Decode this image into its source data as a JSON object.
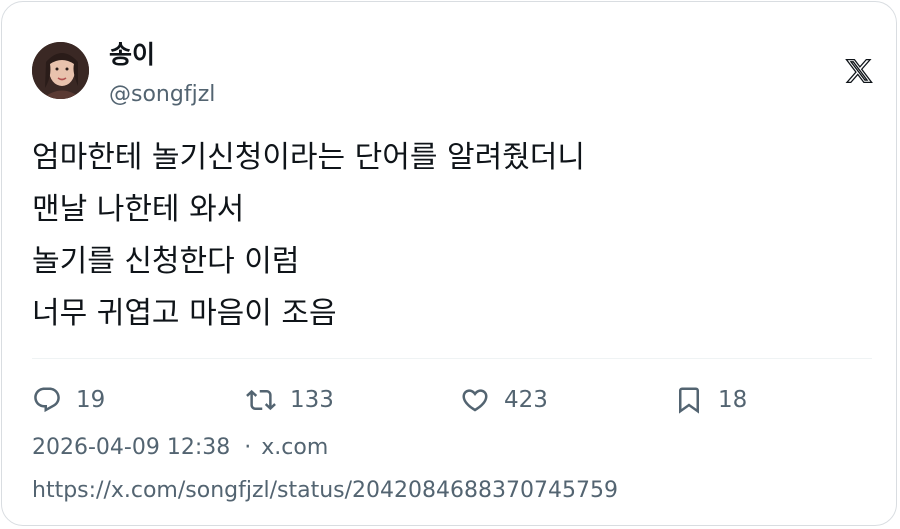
{
  "author": {
    "display_name": "송이",
    "handle": "@songfjzl",
    "avatar_icon": "profile-photo"
  },
  "brand_icon": "x-logo-icon",
  "tweet": {
    "lines": [
      "엄마한테 놀기신청이라는 단어를 알려줬더니",
      "맨날 나한테 와서",
      "놀기를 신청한다 이럼",
      "너무 귀엽고 마음이 조음"
    ]
  },
  "actions": {
    "replies": "19",
    "retweets": "133",
    "likes": "423",
    "bookmarks": "18"
  },
  "meta": {
    "timestamp": "2026-04-09 12:38",
    "separator": "·",
    "source": "x.com"
  },
  "url": "https://x.com/songfjzl/status/2042084688370745759",
  "colors": {
    "text": "#0f1419",
    "muted": "#536471",
    "border": "#d9dde1"
  }
}
